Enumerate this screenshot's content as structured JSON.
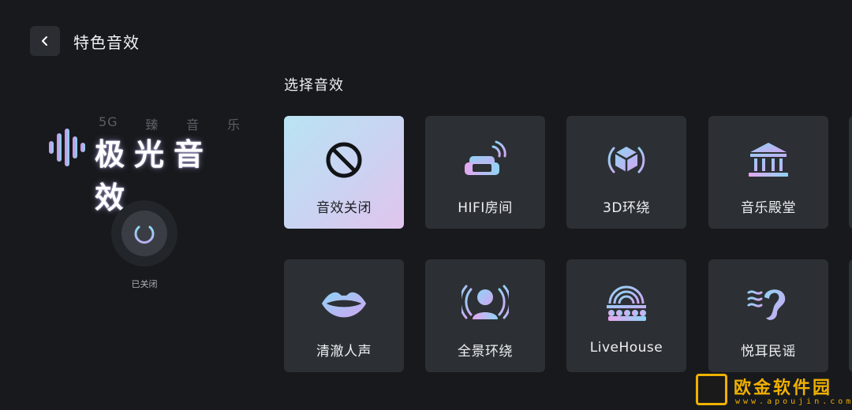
{
  "header": {
    "title": "特色音效"
  },
  "logo": {
    "sub_chars": [
      "5G",
      "臻",
      "音",
      "乐"
    ],
    "main_text": "极光音效"
  },
  "power": {
    "status": "已关闭"
  },
  "section": {
    "title": "选择音效"
  },
  "effects": [
    {
      "label": "音效关闭",
      "icon": "no-sound-icon",
      "active": true
    },
    {
      "label": "HIFI房间",
      "icon": "hifi-room-sofa-icon",
      "active": false
    },
    {
      "label": "3D环绕",
      "icon": "3d-cube-icon",
      "active": false
    },
    {
      "label": "音乐殿堂",
      "icon": "music-hall-icon",
      "active": false
    },
    {
      "label": "清澈人声",
      "icon": "lips-icon",
      "active": false
    },
    {
      "label": "全景环绕",
      "icon": "panorama-person-icon",
      "active": false
    },
    {
      "label": "LiveHouse",
      "icon": "livehouse-stage-icon",
      "active": false
    },
    {
      "label": "悦耳民谣",
      "icon": "ear-icon",
      "active": false
    }
  ],
  "watermark": {
    "text": "欧金软件园",
    "url": "www.apoujin.com"
  },
  "colors": {
    "background": "#17191c",
    "card": "#2c3034",
    "active_gradient_start": "#b9e4f3",
    "active_gradient_end": "#e1c4ec",
    "icon_gradient_blue": "#8fd3f4",
    "icon_gradient_purple": "#c8a2f0",
    "watermark": "#f0b000"
  }
}
